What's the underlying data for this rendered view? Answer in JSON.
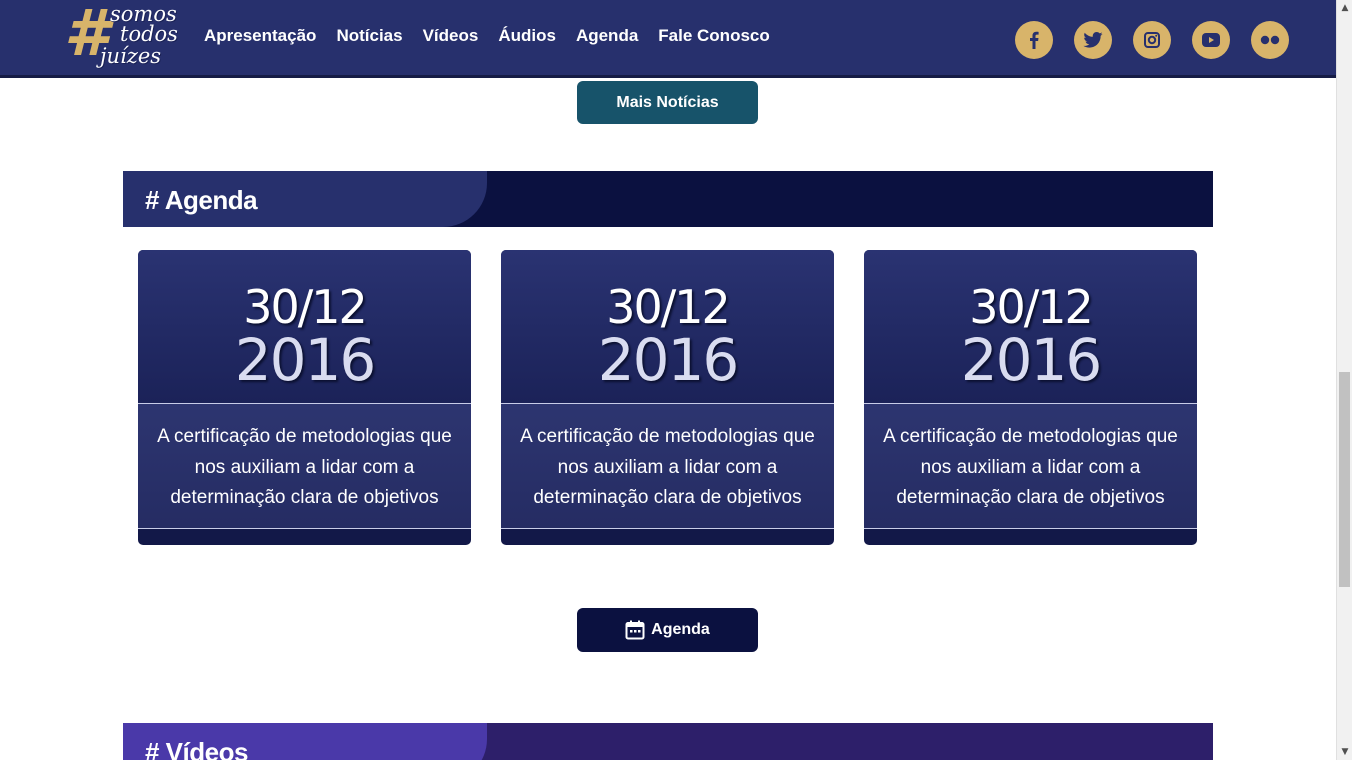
{
  "header": {
    "logo": {
      "text_line1": "somos",
      "text_line2": "todos",
      "text_line3": "juízes",
      "hash": "#"
    },
    "nav": [
      {
        "label": "Apresentação"
      },
      {
        "label": "Notícias"
      },
      {
        "label": "Vídeos"
      },
      {
        "label": "Áudios"
      },
      {
        "label": "Agenda"
      },
      {
        "label": "Fale Conosco"
      }
    ],
    "social": [
      {
        "icon": "facebook-icon"
      },
      {
        "icon": "twitter-icon"
      },
      {
        "icon": "instagram-icon"
      },
      {
        "icon": "youtube-icon"
      },
      {
        "icon": "flickr-icon"
      }
    ]
  },
  "news": {
    "more_button": "Mais Notícias"
  },
  "agenda": {
    "title": "# Agenda",
    "cards": [
      {
        "day": "30/12",
        "year": "2016",
        "description": "A certificação de metodologias que nos auxiliam a lidar com a determinação clara de objetivos"
      },
      {
        "day": "30/12",
        "year": "2016",
        "description": "A certificação de metodologias que nos auxiliam a lidar com a determinação clara de objetivos"
      },
      {
        "day": "30/12",
        "year": "2016",
        "description": "A certificação de metodologias que nos auxiliam a lidar com a determinação clara de objetivos"
      }
    ],
    "button": "Agenda",
    "button_icon": "calendar-icon"
  },
  "videos": {
    "title": "# Vídeos"
  },
  "colors": {
    "header_bg": "#27306d",
    "accent_gold": "#d8b46a",
    "news_button": "#17536a",
    "dark_navy": "#0b1140",
    "videos_purple": "#4a39a9"
  },
  "scrollbar": {
    "up_arrow": "▲",
    "down_arrow": "▼"
  }
}
